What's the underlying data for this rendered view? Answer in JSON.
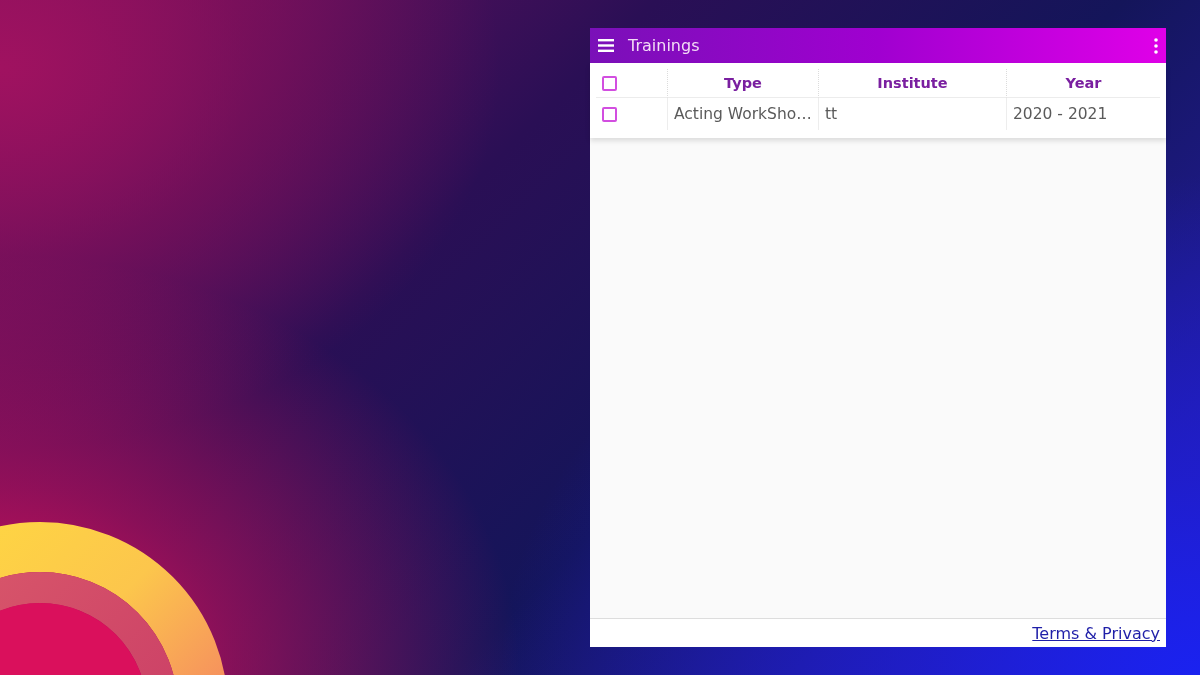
{
  "window": {
    "title": "Trainings"
  },
  "table": {
    "header_checkbox": {
      "checked": false
    },
    "columns": [
      "Type",
      "Institute",
      "Year"
    ],
    "rows": [
      {
        "checked": false,
        "cells": [
          "Acting WorkSho…",
          "tt",
          "2020 - 2021"
        ]
      }
    ]
  },
  "footer": {
    "link": "Terms & Privacy"
  }
}
